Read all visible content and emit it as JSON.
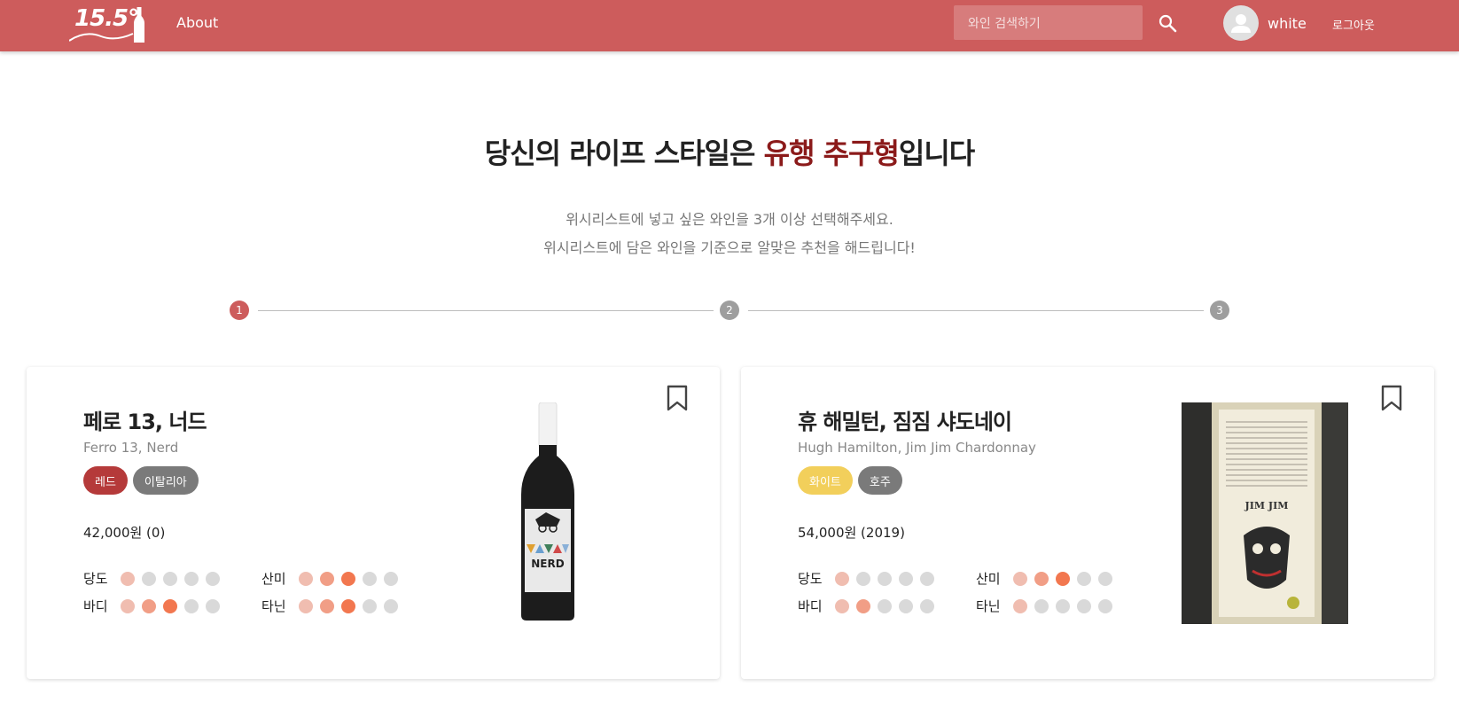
{
  "header": {
    "logo_text": "15.5°",
    "about_label": "About",
    "search_placeholder": "와인 검색하기",
    "username": "white",
    "logout_label": "로그아웃"
  },
  "hero": {
    "title_prefix": "당신의 라이프 스타일은 ",
    "title_accent": "유행 추구형",
    "title_suffix": "입니다",
    "subtitle_line1": "위시리스트에 넣고 싶은 와인을 3개 이상 선택해주세요.",
    "subtitle_line2": "위시리스트에 담은 와인을 기준으로 알맞은 추천을 해드립니다!"
  },
  "stepper": {
    "steps": [
      "1",
      "2",
      "3"
    ],
    "active_step": 1
  },
  "colors": {
    "header_bg": "#cd5c5c",
    "accent_text": "#8b1a1a",
    "tag_red": "#b53a3a",
    "tag_white": "#f2cf5b",
    "tag_country": "#7a7a7a"
  },
  "wines": [
    {
      "name_ko": "페로 13, 너드",
      "name_en": "Ferro 13, Nerd",
      "type_tag": "레드",
      "country_tag": "이탈리아",
      "price": "42,000원 (0)",
      "bottle_label": "NERD",
      "attributes": {
        "sweetness": {
          "label": "당도",
          "level": 1
        },
        "acidity": {
          "label": "산미",
          "level": 3
        },
        "body": {
          "label": "바디",
          "level": 3
        },
        "tannin": {
          "label": "타닌",
          "level": 3
        }
      }
    },
    {
      "name_ko": "휴 해밀턴, 짐짐 샤도네이",
      "name_en": "Hugh Hamilton, Jim Jim Chardonnay",
      "type_tag": "화이트",
      "country_tag": "호주",
      "price": "54,000원 (2019)",
      "bottle_label": "JIM JIM",
      "attributes": {
        "sweetness": {
          "label": "당도",
          "level": 1
        },
        "acidity": {
          "label": "산미",
          "level": 3
        },
        "body": {
          "label": "바디",
          "level": 2
        },
        "tannin": {
          "label": "타닌",
          "level": 1
        }
      }
    }
  ]
}
